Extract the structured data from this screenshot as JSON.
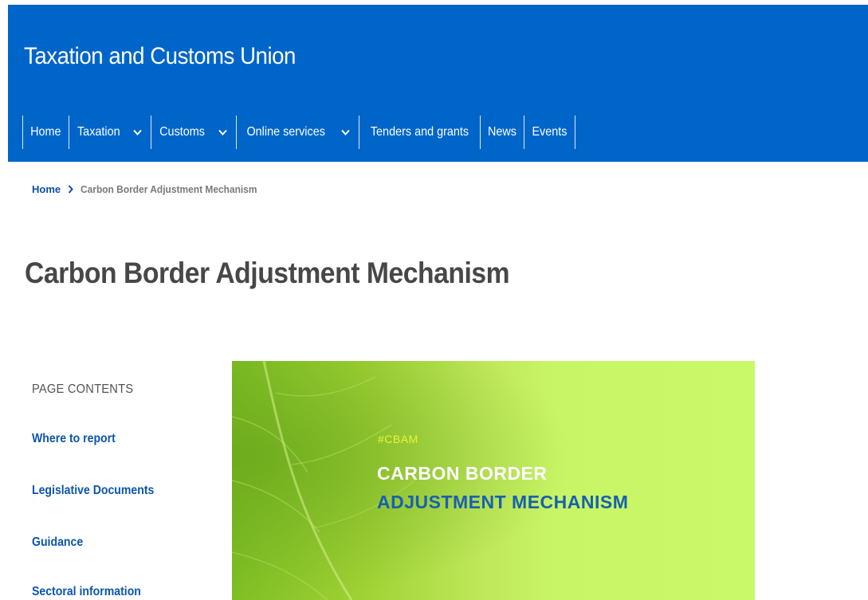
{
  "header": {
    "site_title": "Taxation and Customs Union",
    "nav": [
      {
        "label": "Home",
        "dropdown": false
      },
      {
        "label": "Taxation",
        "dropdown": true
      },
      {
        "label": "Customs",
        "dropdown": true
      },
      {
        "label": "Online services",
        "dropdown": true
      },
      {
        "label": "Tenders and grants",
        "dropdown": false
      },
      {
        "label": "News",
        "dropdown": false
      },
      {
        "label": "Events",
        "dropdown": false
      }
    ]
  },
  "breadcrumb": {
    "home": "Home",
    "current": "Carbon Border Adjustment Mechanism"
  },
  "page_title": "Carbon Border Adjustment Mechanism",
  "toc": {
    "heading": "PAGE CONTENTS",
    "items": [
      "Where to report",
      "Legislative Documents",
      "Guidance",
      "Sectoral information"
    ]
  },
  "banner": {
    "tag": "#CBAM",
    "line1": "CARBON BORDER",
    "line2": "ADJUSTMENT MECHANISM"
  },
  "colors": {
    "header_blue": "#0065c8",
    "link_blue": "#0b56ad",
    "banner_green": "#c8f565"
  },
  "icons": {
    "nav_dropdown": "chevron-down-icon",
    "breadcrumb_separator": "chevron-right-icon"
  }
}
